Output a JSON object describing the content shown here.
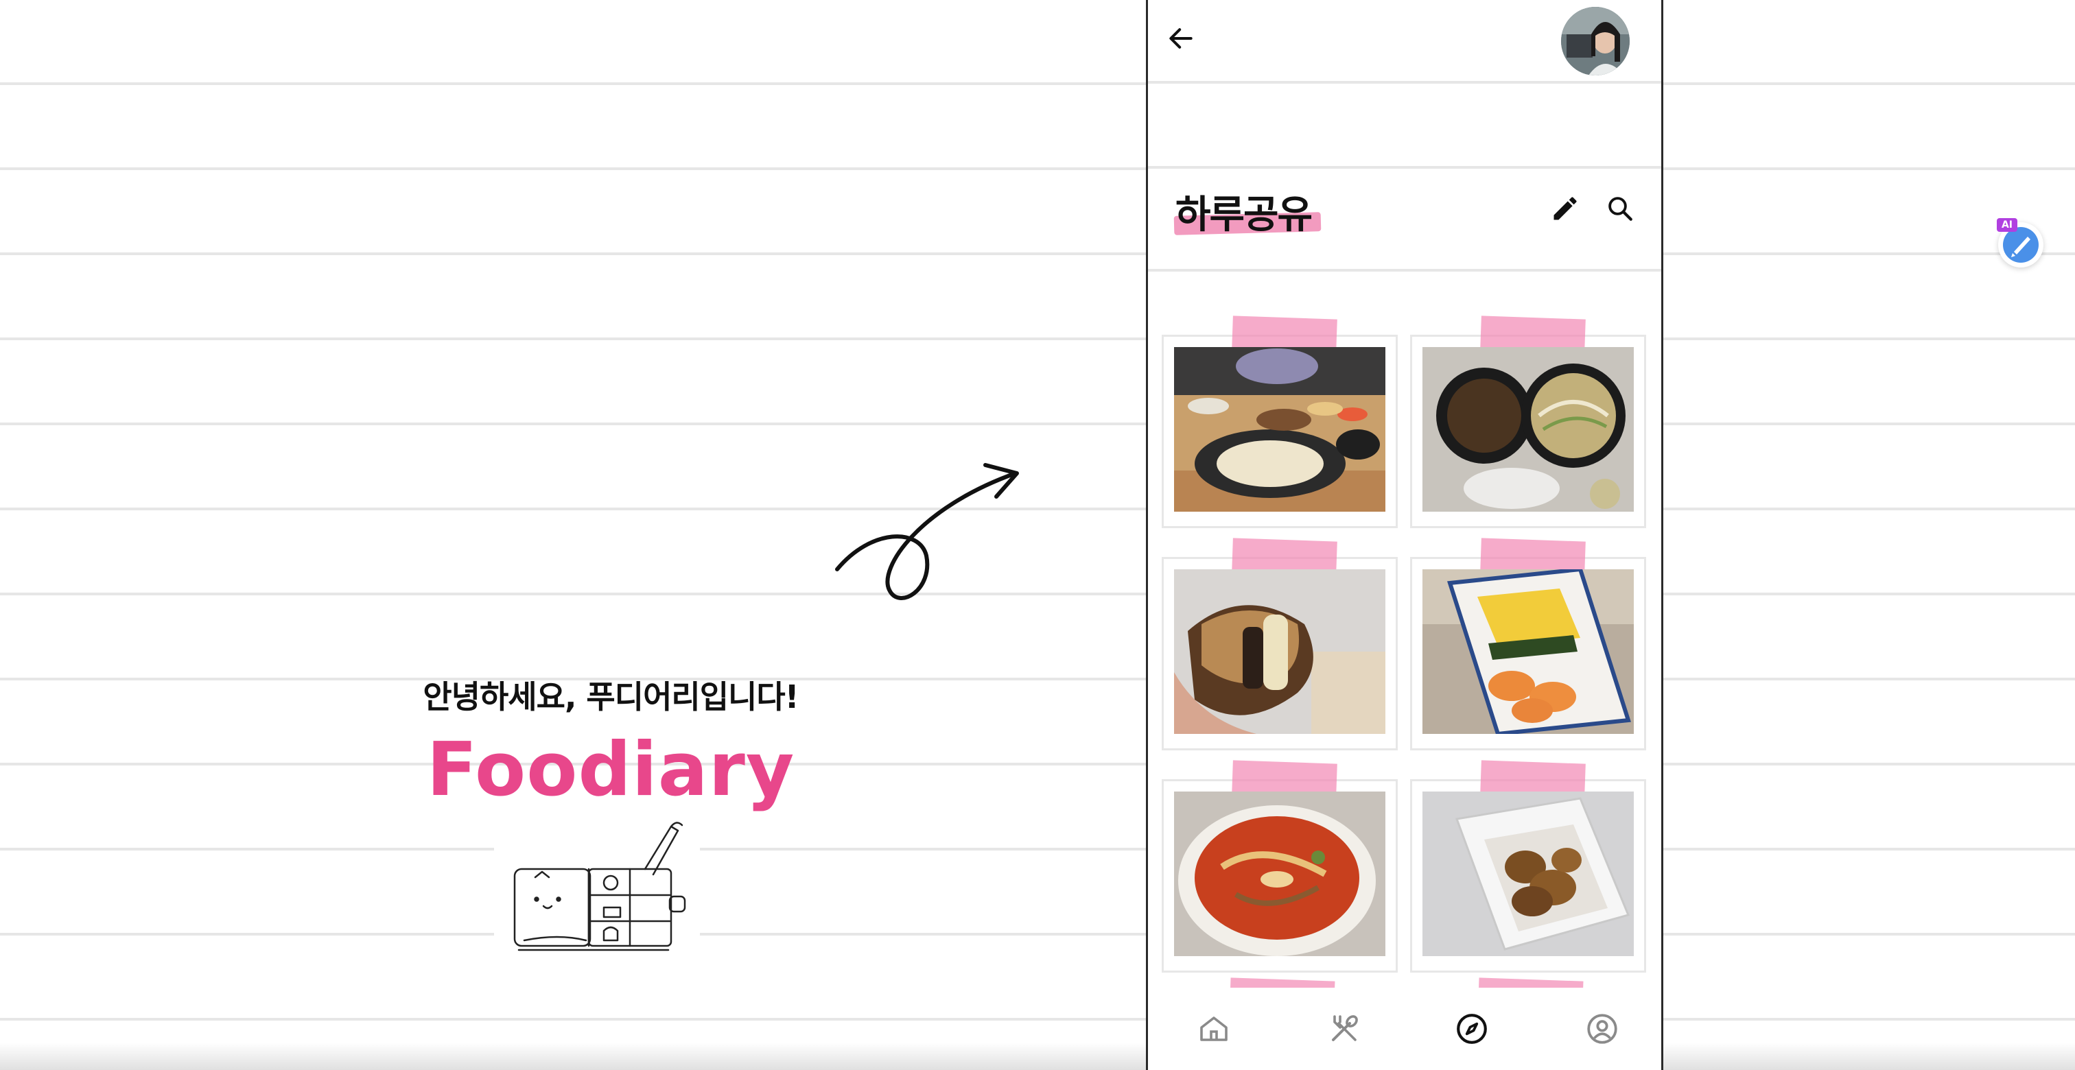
{
  "intro": {
    "greeting": "안녕하세요, 푸디어리입니다!",
    "brand": "Foodiary",
    "brand_color": "#e8478b",
    "illustration_icon": "diary-with-pen-illustration",
    "arrow_icon": "swirl-arrow"
  },
  "app": {
    "back_icon": "arrow-left-icon",
    "avatar_alt": "user-profile-photo",
    "page_title": "하루공유",
    "title_highlight_color": "#f29bbf",
    "edit_icon": "pencil-icon",
    "search_icon": "search-icon",
    "tape_color": "#f287b4",
    "posts": [
      {
        "photo": "table-of-udon-noodles-and-side-dishes"
      },
      {
        "photo": "jajangmyeon-and-noodle-soup-takeout"
      },
      {
        "photo": "fried-sandwich-in-paper"
      },
      {
        "photo": "rolled-egg-and-sushi-plate"
      },
      {
        "photo": "spicy-red-stew-bowl"
      },
      {
        "photo": "fried-chicken-in-paper-box"
      }
    ],
    "nav": [
      {
        "name": "home",
        "icon": "home-icon"
      },
      {
        "name": "restaurants",
        "icon": "fork-spoon-icon"
      },
      {
        "name": "explore",
        "icon": "compass-icon",
        "active": true
      },
      {
        "name": "profile",
        "icon": "user-circle-icon"
      }
    ]
  },
  "ai_widget": {
    "badge": "AI",
    "icon": "ai-assistant-icon",
    "accent": "#4a90e8"
  }
}
